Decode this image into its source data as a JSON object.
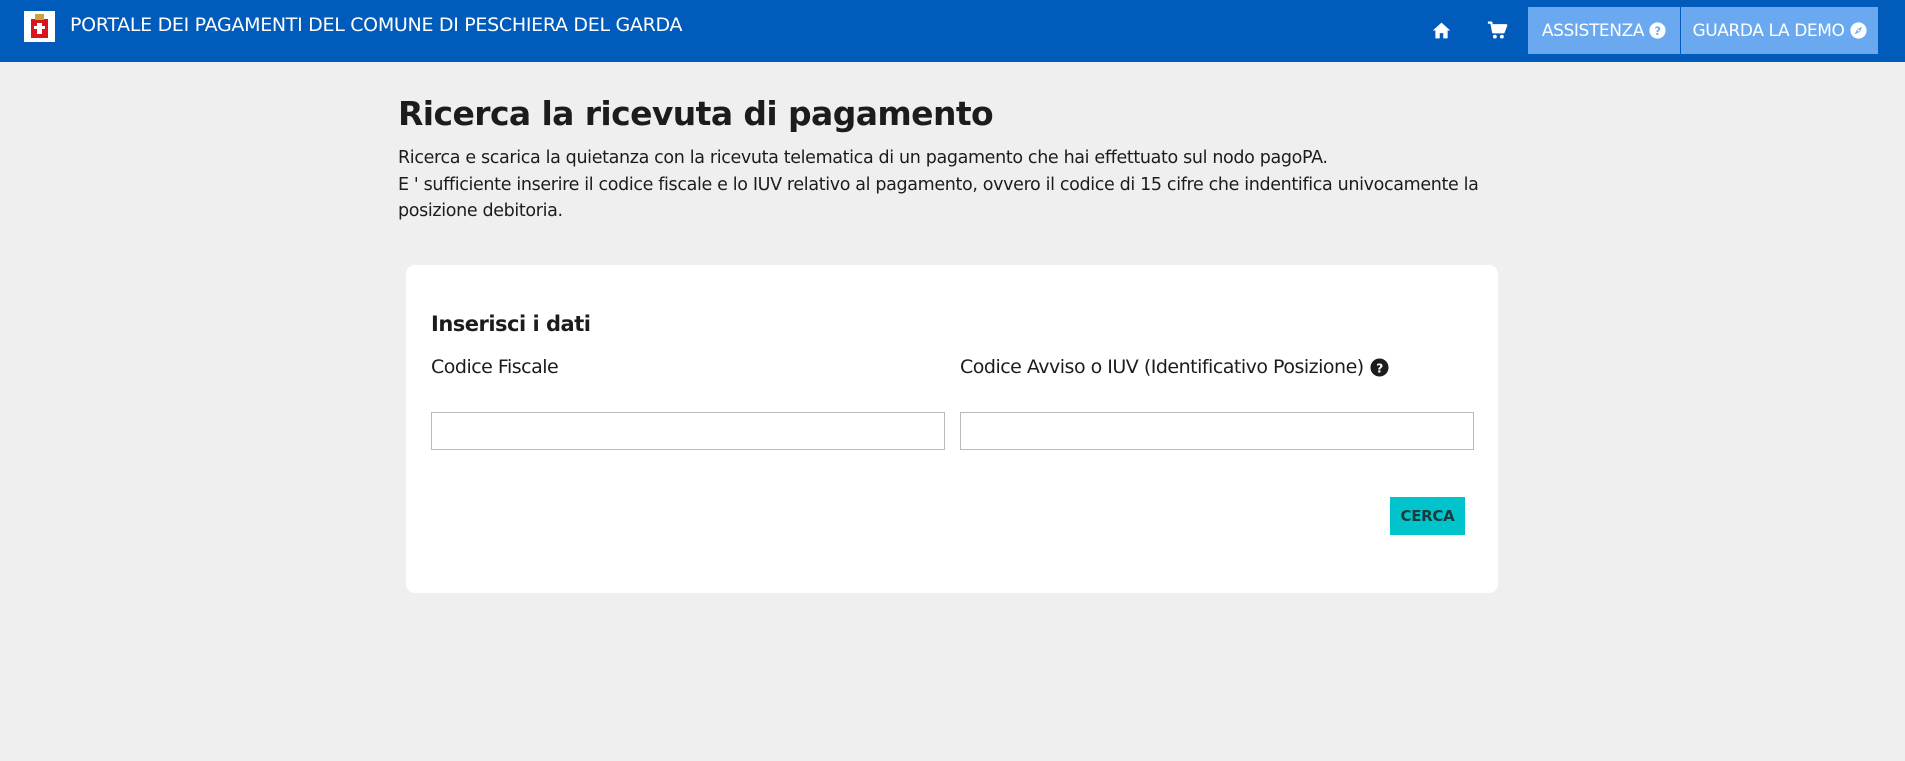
{
  "header": {
    "title": "PORTALE DEI PAGAMENTI DEL COMUNE DI PESCHIERA DEL GARDA",
    "logo_icon": "municipal-crest-icon",
    "home_icon": "home-icon",
    "cart_icon": "cart-icon",
    "assistance_label": "ASSISTENZA",
    "assistance_icon": "question-circle-icon",
    "demo_label": "GUARDA LA DEMO",
    "demo_icon": "compass-icon",
    "background_color": "#005bbb",
    "button_color": "#6aa9ef"
  },
  "main": {
    "title": "Ricerca la ricevuta di pagamento",
    "intro_line1": "Ricerca e scarica la quietanza con la ricevuta telematica di un pagamento che hai effettuato sul nodo pagoPA.",
    "intro_line2": "E ' sufficiente inserire il codice fiscale e lo IUV relativo al pagamento, ovvero il codice di 15 cifre che indentifica univocamente la posizione debitoria."
  },
  "form": {
    "title": "Inserisci i dati",
    "codice_fiscale_label": "Codice Fiscale",
    "codice_fiscale_value": "",
    "iuv_label": "Codice Avviso o IUV (Identificativo Posizione)",
    "iuv_help_icon": "question-circle-icon",
    "iuv_value": "",
    "search_label": "CERCA",
    "search_button_color": "#00c3cb"
  }
}
